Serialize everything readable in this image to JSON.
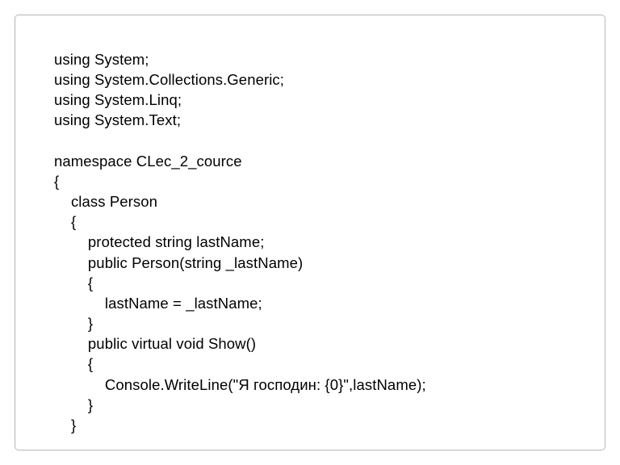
{
  "code": {
    "lines": [
      "using System;",
      "using System.Collections.Generic;",
      "using System.Linq;",
      "using System.Text;",
      "",
      "namespace CLec_2_cource",
      "{",
      "    class Person",
      "    {",
      "        protected string lastName;",
      "        public Person(string _lastName)",
      "        {",
      "            lastName = _lastName;",
      "        }",
      "        public virtual void Show()",
      "        {",
      "            Console.WriteLine(\"Я господин: {0}\",lastName);",
      "        }",
      "    }"
    ]
  }
}
